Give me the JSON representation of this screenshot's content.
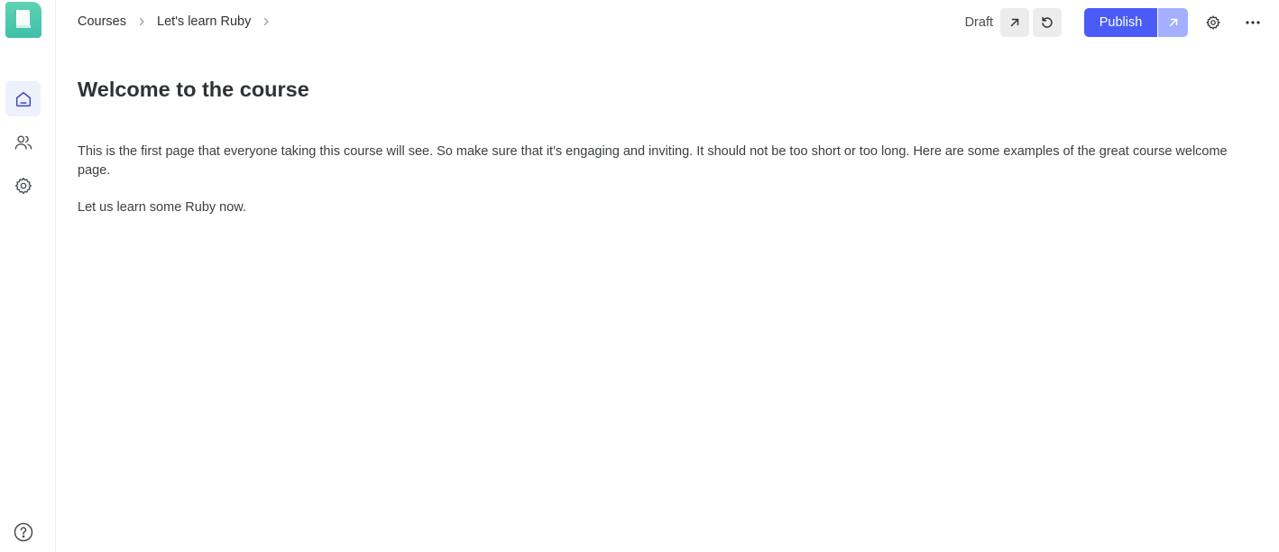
{
  "app": {
    "logo": "book-logo",
    "colors": {
      "accent": "#4a5cf5",
      "accent_light": "#a5afff",
      "logo": "#4fcbb0",
      "active_nav_bg": "#eef0fb"
    }
  },
  "sidebar": {
    "items": [
      {
        "icon": "home-icon",
        "active": true
      },
      {
        "icon": "users-icon",
        "active": false
      },
      {
        "icon": "gear-icon",
        "active": false
      }
    ],
    "footer_icon": "help-icon"
  },
  "header": {
    "breadcrumbs": [
      "Courses",
      "Let's learn Ruby"
    ],
    "status": "Draft",
    "publish_label": "Publish"
  },
  "page": {
    "title": "Welcome to the course",
    "paragraphs": [
      "This is the first page that everyone taking this course will see. So make sure that it's engaging and inviting. It should not be too short or too long. Here are some examples of the great course welcome page.",
      "Let us learn some Ruby now."
    ]
  }
}
